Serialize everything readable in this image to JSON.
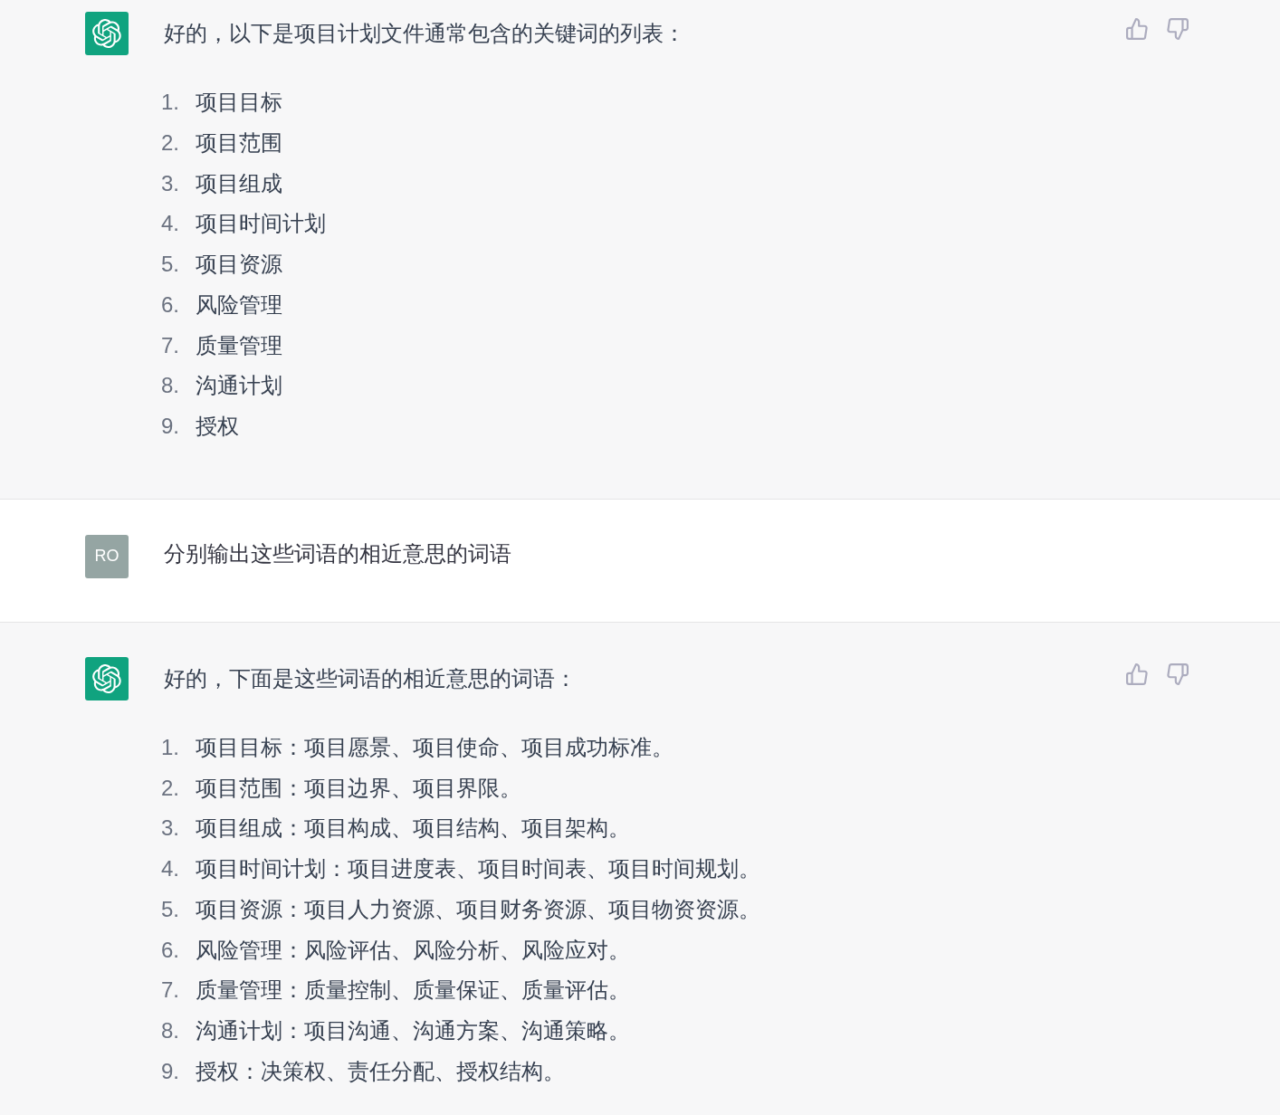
{
  "messages": [
    {
      "kind": "assistant",
      "intro": "好的，以下是项目计划文件通常包含的关键词的列表：",
      "list": [
        {
          "number": "1.",
          "text": "项目目标"
        },
        {
          "number": "2.",
          "text": "项目范围"
        },
        {
          "number": "3.",
          "text": "项目组成"
        },
        {
          "number": "4.",
          "text": "项目时间计划"
        },
        {
          "number": "5.",
          "text": "项目资源"
        },
        {
          "number": "6.",
          "text": "风险管理"
        },
        {
          "number": "7.",
          "text": "质量管理"
        },
        {
          "number": "8.",
          "text": "沟通计划"
        },
        {
          "number": "9.",
          "text": "授权"
        }
      ]
    },
    {
      "kind": "user",
      "initials": "RO",
      "text": "分别输出这些词语的相近意思的词语"
    },
    {
      "kind": "assistant",
      "intro": "好的，下面是这些词语的相近意思的词语：",
      "list": [
        {
          "number": "1.",
          "text": "项目目标：项目愿景、项目使命、项目成功标准。"
        },
        {
          "number": "2.",
          "text": "项目范围：项目边界、项目界限。"
        },
        {
          "number": "3.",
          "text": "项目组成：项目构成、项目结构、项目架构。"
        },
        {
          "number": "4.",
          "text": "项目时间计划：项目进度表、项目时间表、项目时间规划。"
        },
        {
          "number": "5.",
          "text": "项目资源：项目人力资源、项目财务资源、项目物资资源。"
        },
        {
          "number": "6.",
          "text": "风险管理：风险评估、风险分析、风险应对。"
        },
        {
          "number": "7.",
          "text": "质量管理：质量控制、质量保证、质量评估。"
        },
        {
          "number": "8.",
          "text": "沟通计划：项目沟通、沟通方案、沟通策略。"
        },
        {
          "number": "9.",
          "text": "授权：决策权、责任分配、授权结构。"
        }
      ]
    }
  ]
}
